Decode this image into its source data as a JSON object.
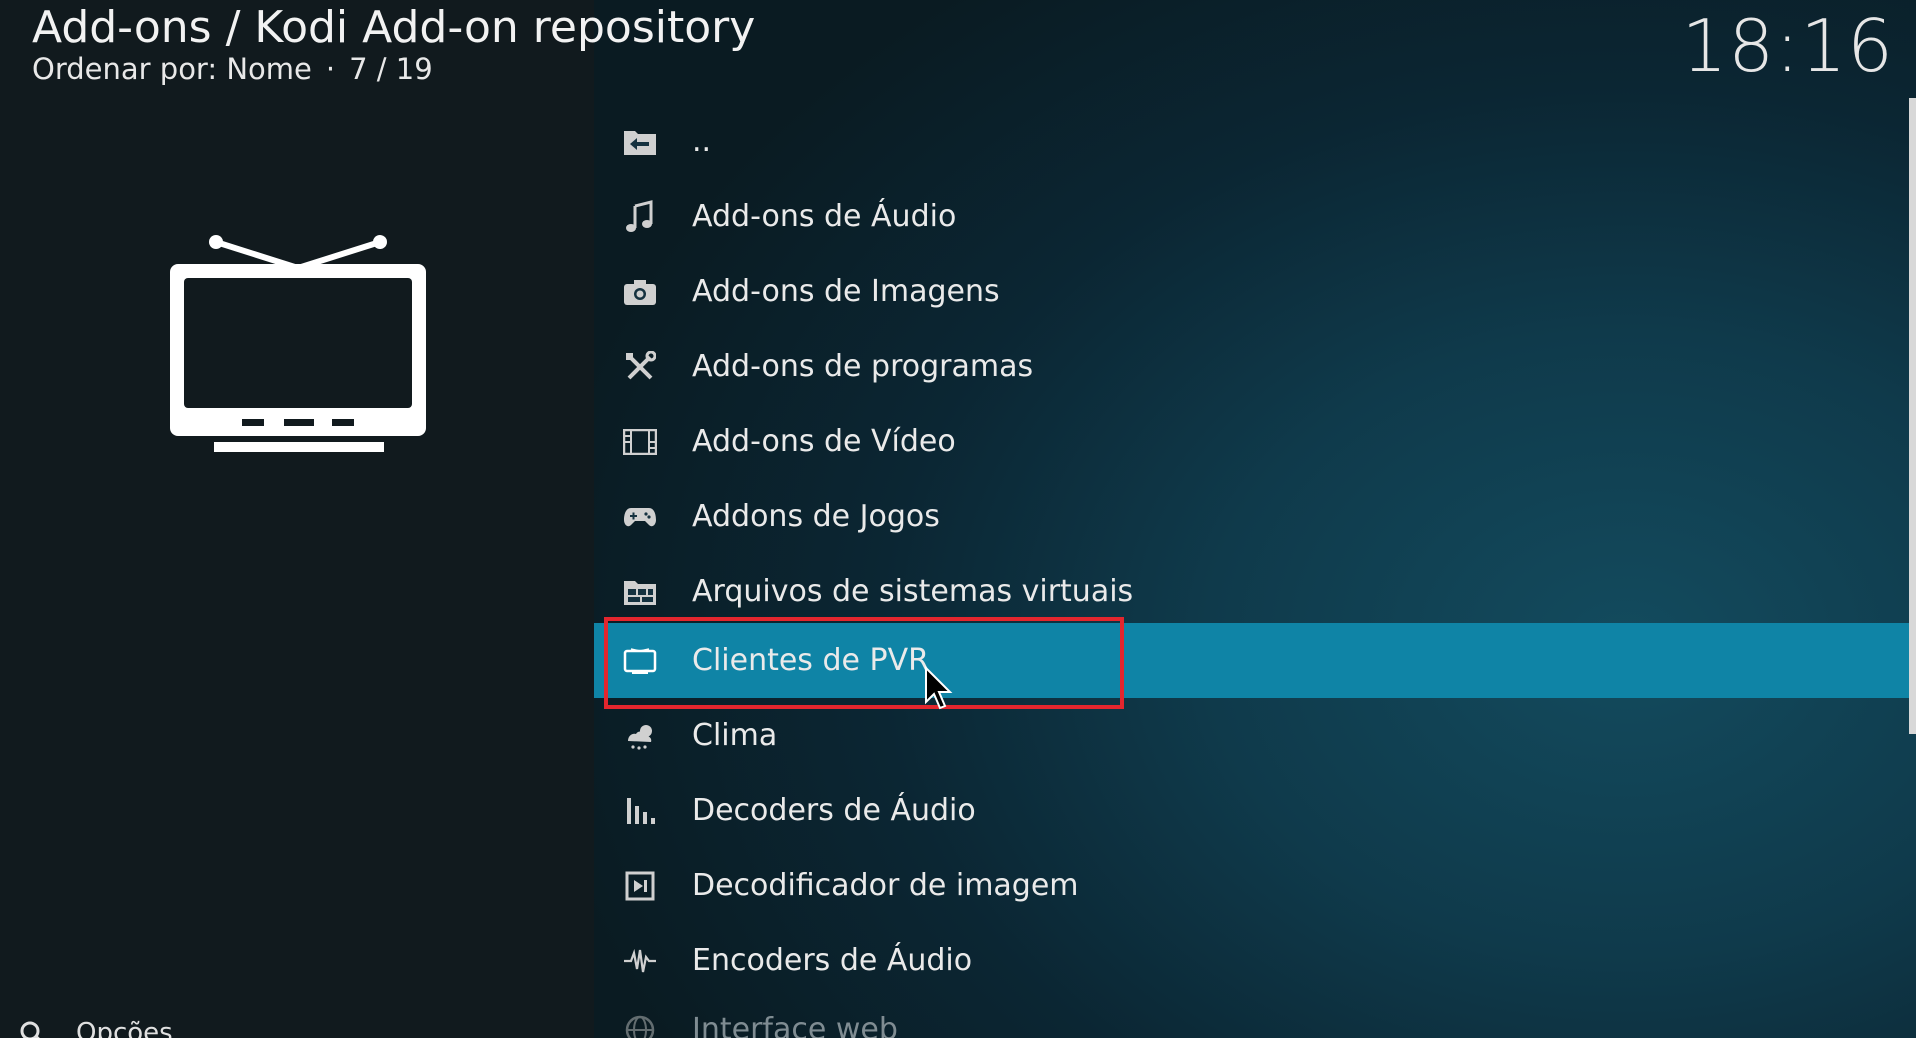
{
  "header": {
    "title": "Add-ons / Kodi Add-on repository",
    "sort_label": "Ordenar por: Nome",
    "separator": "·",
    "position": "7 / 19"
  },
  "clock": "18:16",
  "preview": {
    "icon": "tv-icon"
  },
  "footer": {
    "options_label": "Opções",
    "icon": "wrench-gear-icon"
  },
  "list": {
    "items": [
      {
        "label": "..",
        "icon": "folder-back-icon",
        "selected": false
      },
      {
        "label": "Add-ons de Áudio",
        "icon": "music-note-icon",
        "selected": false
      },
      {
        "label": "Add-ons de Imagens",
        "icon": "camera-icon",
        "selected": false
      },
      {
        "label": "Add-ons de programas",
        "icon": "tools-icon",
        "selected": false
      },
      {
        "label": "Add-ons de Vídeo",
        "icon": "film-strip-icon",
        "selected": false
      },
      {
        "label": "Addons de Jogos",
        "icon": "gamepad-icon",
        "selected": false
      },
      {
        "label": "Arquivos de sistemas virtuais",
        "icon": "archive-folder-icon",
        "selected": false
      },
      {
        "label": "Clientes de PVR",
        "icon": "tv-icon",
        "selected": true
      },
      {
        "label": "Clima",
        "icon": "weather-icon",
        "selected": false
      },
      {
        "label": "Decoders de Áudio",
        "icon": "audio-bars-icon",
        "selected": false
      },
      {
        "label": "Decodificador de imagem",
        "icon": "image-frame-icon",
        "selected": false
      },
      {
        "label": "Encoders de Áudio",
        "icon": "waveform-icon",
        "selected": false
      },
      {
        "label": "Interface web",
        "icon": "globe-icon",
        "selected": false
      }
    ]
  },
  "colors": {
    "selected_bg": "#0f84a6",
    "highlight_border": "#e3262e",
    "text": "#eaeaea"
  }
}
